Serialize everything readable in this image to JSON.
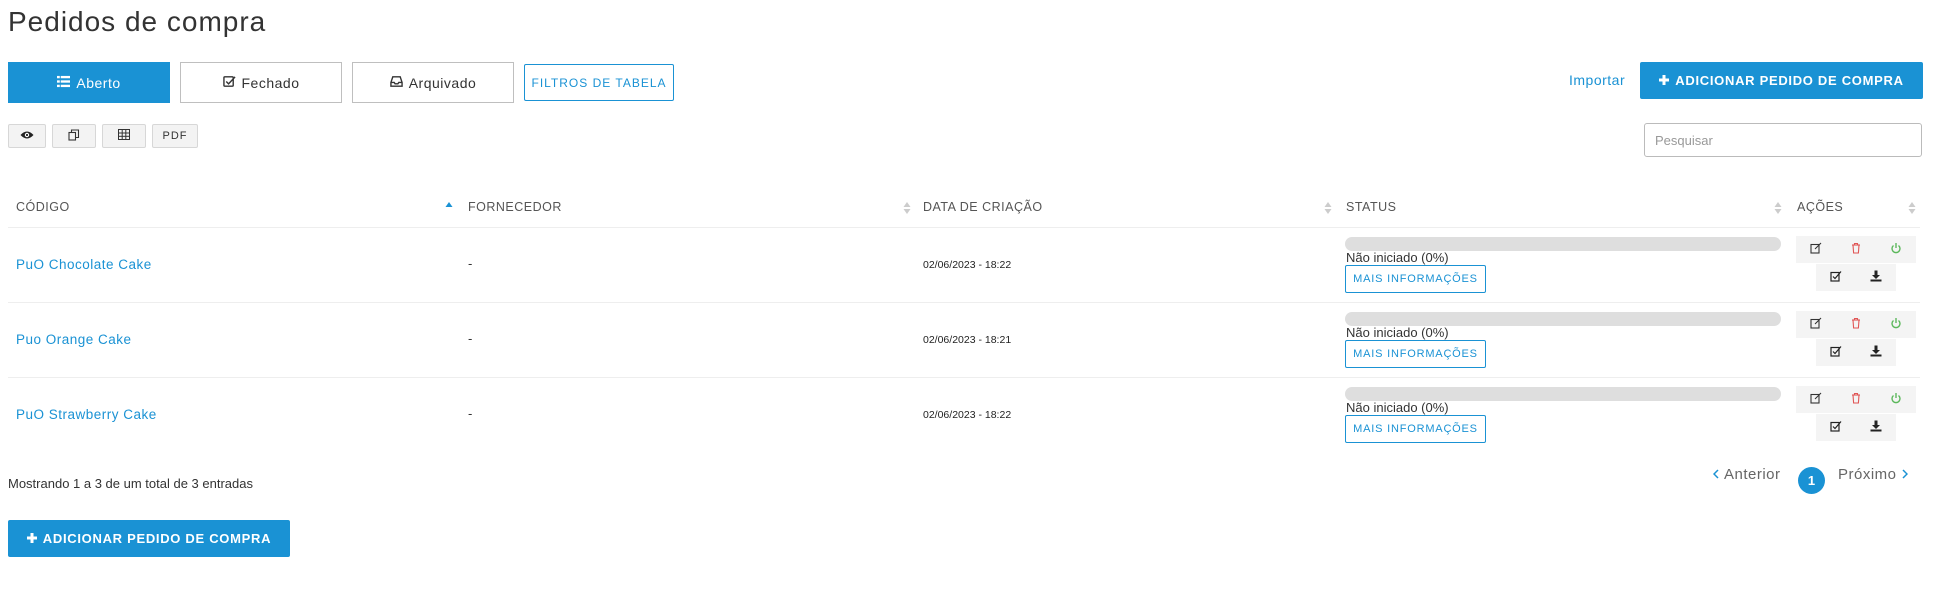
{
  "page": {
    "title": "Pedidos de compra"
  },
  "tabs": [
    {
      "label": "Aberto",
      "icon": "list-icon",
      "active": true
    },
    {
      "label": "Fechado",
      "icon": "checkbox-icon",
      "active": false
    },
    {
      "label": "Arquivado",
      "icon": "inbox-icon",
      "active": false
    }
  ],
  "toolbar": {
    "filters_label": "FILTROS DE TABELA",
    "import_label": "Importar",
    "add_label": "ADICIONAR PEDIDO DE COMPRA",
    "export_buttons": [
      {
        "icon": "eye-icon"
      },
      {
        "icon": "copy-icon"
      },
      {
        "icon": "table-icon"
      },
      {
        "label": "PDF"
      }
    ],
    "search_placeholder": "Pesquisar"
  },
  "table": {
    "columns": [
      "CÓDIGO",
      "FORNECEDOR",
      "DATA DE CRIAÇÃO",
      "STATUS",
      "AÇÕES"
    ],
    "rows": [
      {
        "code": "PuO Chocolate Cake",
        "supplier": "-",
        "created": "02/06/2023 - 18:22",
        "status": "Não iniciado (0%)",
        "progress": 0,
        "more": "MAIS INFORMAÇÕES"
      },
      {
        "code": "Puo Orange Cake",
        "supplier": "-",
        "created": "02/06/2023 - 18:21",
        "status": "Não iniciado (0%)",
        "progress": 0,
        "more": "MAIS INFORMAÇÕES"
      },
      {
        "code": "PuO Strawberry Cake",
        "supplier": "-",
        "created": "02/06/2023 - 18:22",
        "status": "Não iniciado (0%)",
        "progress": 0,
        "more": "MAIS INFORMAÇÕES"
      }
    ],
    "action_icons": [
      "edit-icon",
      "trash-icon",
      "power-icon",
      "check-icon",
      "download-icon"
    ]
  },
  "footer": {
    "info": "Mostrando 1 a 3 de um total de 3 entradas",
    "prev": "Anterior",
    "next": "Próximo",
    "current_page": "1"
  },
  "colors": {
    "accent": "#1a92d4",
    "delete": "#e05555",
    "power": "#5cb85c"
  }
}
